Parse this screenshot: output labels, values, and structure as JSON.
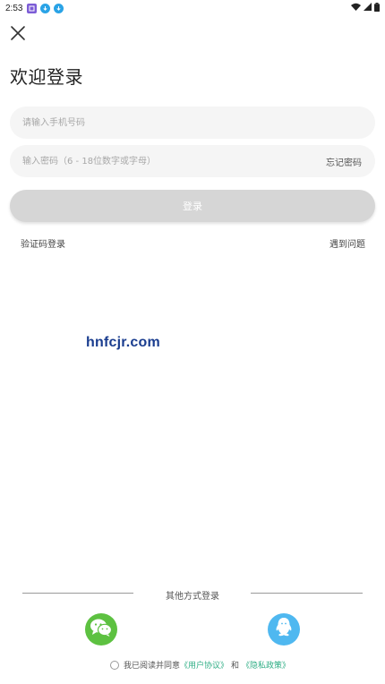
{
  "status_bar": {
    "time": "2:53",
    "notification_icons": [
      "app-notification-icon",
      "download-icon",
      "download-icon"
    ],
    "right_icons": [
      "wifi-icon",
      "signal-icon",
      "battery-icon"
    ]
  },
  "header": {
    "close_icon": "close-icon",
    "title": "欢迎登录"
  },
  "form": {
    "phone_placeholder": "请输入手机号码",
    "password_placeholder": "输入密码（6 - 18位数字或字母）",
    "forgot_password": "忘记密码",
    "login_button": "登录",
    "sms_login": "验证码登录",
    "help": "遇到问题"
  },
  "watermark": "hnfcjr.com",
  "other_login": {
    "label": "其他方式登录",
    "providers": [
      "wechat-icon",
      "qq-icon"
    ]
  },
  "agreement": {
    "prefix": "我已阅读并同意",
    "user_agreement": "《用户协议》",
    "and": "和",
    "privacy_policy": "《隐私政策》"
  },
  "colors": {
    "login_button_disabled": "#d6d6d6",
    "input_background": "#f5f5f5",
    "wechat_green": "#5dc141",
    "qq_blue": "#4fb8f0",
    "agreement_link": "#2fae85",
    "watermark_blue": "#1a3d8f"
  }
}
